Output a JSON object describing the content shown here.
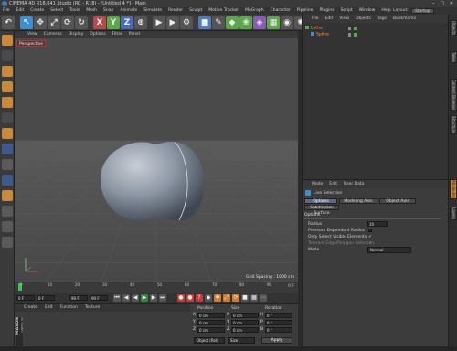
{
  "window": {
    "title": "CINEMA 4D R18.041 Studio (RC - R18) - [Untitled 4 *] - Main",
    "controls": [
      "–",
      "□",
      "✕"
    ]
  },
  "menubar": {
    "items": [
      "File",
      "Edit",
      "Create",
      "Select",
      "Tools",
      "Mesh",
      "Snap",
      "Animate",
      "Simulate",
      "Render",
      "Sculpt",
      "Motion Tracker",
      "MoGraph",
      "Character",
      "Pipeline",
      "Plugins",
      "Script",
      "Window",
      "Help"
    ],
    "layout_label": "Layout:",
    "layout_value": "Startup"
  },
  "toolbar": {
    "buttons": [
      {
        "name": "undo",
        "glyph": "↶"
      },
      {
        "name": "live-selection",
        "glyph": "↖"
      },
      {
        "name": "move",
        "glyph": "✥"
      },
      {
        "name": "scale",
        "glyph": "⤢"
      },
      {
        "name": "rotate",
        "glyph": "⟳"
      },
      {
        "name": "recent",
        "glyph": "↻"
      },
      {
        "name": "x-axis",
        "glyph": "X"
      },
      {
        "name": "y-axis",
        "glyph": "Y"
      },
      {
        "name": "z-axis",
        "glyph": "Z"
      },
      {
        "name": "coordinate-system",
        "glyph": "⊕"
      },
      {
        "name": "render-view",
        "glyph": "▶"
      },
      {
        "name": "render-picture-viewer",
        "glyph": "▶"
      },
      {
        "name": "render-settings",
        "glyph": "⚙"
      },
      {
        "name": "cube",
        "glyph": "■"
      },
      {
        "name": "pen",
        "glyph": "✎"
      },
      {
        "name": "subdivision",
        "glyph": "◆"
      },
      {
        "name": "cloner",
        "glyph": "❀"
      },
      {
        "name": "deformer",
        "glyph": "◈"
      },
      {
        "name": "floor",
        "glyph": "▦"
      },
      {
        "name": "camera",
        "glyph": "◉"
      },
      {
        "name": "light",
        "glyph": "✺"
      }
    ]
  },
  "viewport": {
    "menu": [
      "View",
      "Cameras",
      "Display",
      "Options",
      "Filter",
      "Panel"
    ],
    "camera_label": "Perspective",
    "grid_spacing": "Grid Spacing : 1000 cm"
  },
  "timeline": {
    "ticks": [
      "0",
      "10",
      "20",
      "30",
      "40",
      "50",
      "60",
      "70",
      "80",
      "90"
    ],
    "end_frame": "0 F"
  },
  "transport": {
    "current_frame": "0 F",
    "start_field": "0 F",
    "end_field": "90 F",
    "end_field2": "90 F"
  },
  "materials": {
    "menu": [
      "Create",
      "Edit",
      "Function",
      "Texture"
    ],
    "brand": "MAXON",
    "brand_sub": "CINEMA 4D"
  },
  "coordinates": {
    "headers": [
      "Position",
      "Size",
      "Rotation"
    ],
    "rows": [
      {
        "axis": "X",
        "pos": "0 cm",
        "size": "0 cm",
        "rot_axis": "H",
        "rot": "0 °"
      },
      {
        "axis": "Y",
        "pos": "0 cm",
        "size": "0 cm",
        "rot_axis": "P",
        "rot": "0 °"
      },
      {
        "axis": "Z",
        "pos": "0 cm",
        "size": "0 cm",
        "rot_axis": "B",
        "rot": "0 °"
      }
    ],
    "mode_select": "Object (Rel)",
    "size_select": "Size",
    "apply_label": "Apply"
  },
  "objects": {
    "menu": [
      "File",
      "Edit",
      "View",
      "Objects",
      "Tags",
      "Bookmarks"
    ],
    "items": [
      {
        "name": "Lathe",
        "indent": 0
      },
      {
        "name": "Spline",
        "indent": 1
      }
    ]
  },
  "attributes": {
    "menu": [
      "Mode",
      "Edit",
      "User Data"
    ],
    "tool_title": "Live Selection",
    "tabs": [
      "Options",
      "Modeling Axis",
      "Object Axis"
    ],
    "subtab": "Subdivision Surface",
    "section": "Options",
    "props": {
      "radius_label": "Radius",
      "radius_value": "10",
      "pressure_label": "Pressure Dependent Radius . .",
      "only_visible_label": "Only Select Visible Elements",
      "tolerant_label": "Tolerant Edge/Polygon Selection",
      "mode_label": "Mode",
      "mode_value": "Normal"
    }
  },
  "right_tabs": [
    "Objects",
    "Takes",
    "Content Browser",
    "Structure",
    "Attributes",
    "Layers"
  ]
}
